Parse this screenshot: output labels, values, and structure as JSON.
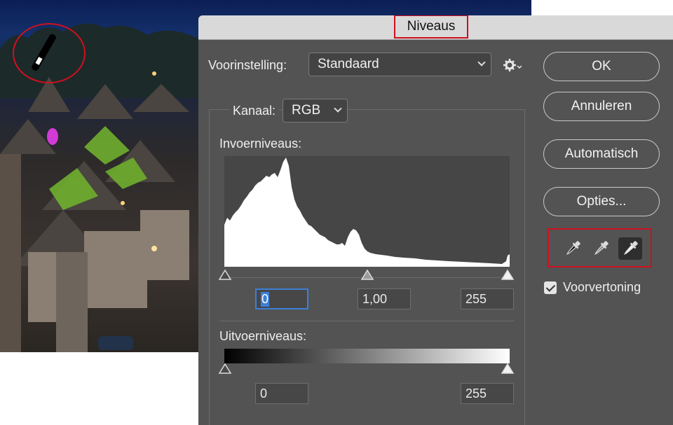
{
  "dialog": {
    "title": "Niveaus",
    "preset_label": "Voorinstelling:",
    "preset_value": "Standaard",
    "channel_label": "Kanaal:",
    "channel_value": "RGB",
    "input_levels_label": "Invoerniveaus:",
    "input_values": [
      "0",
      "1,00",
      "255"
    ],
    "output_levels_label": "Uitvoerniveaus:",
    "output_values": [
      "0",
      "255"
    ],
    "buttons": {
      "ok": "OK",
      "cancel": "Annuleren",
      "auto": "Automatisch",
      "options": "Opties..."
    },
    "preview_label": "Voorvertoning",
    "preview_checked": true,
    "eyedroppers": [
      "black-point-eyedropper-icon",
      "gray-point-eyedropper-icon",
      "white-point-eyedropper-icon"
    ],
    "active_eyedropper": "white-point-eyedropper-icon"
  },
  "colors": {
    "dialog_bg": "#535353",
    "highlight_red": "#d0101e",
    "focus_blue": "#3d7fd6"
  }
}
